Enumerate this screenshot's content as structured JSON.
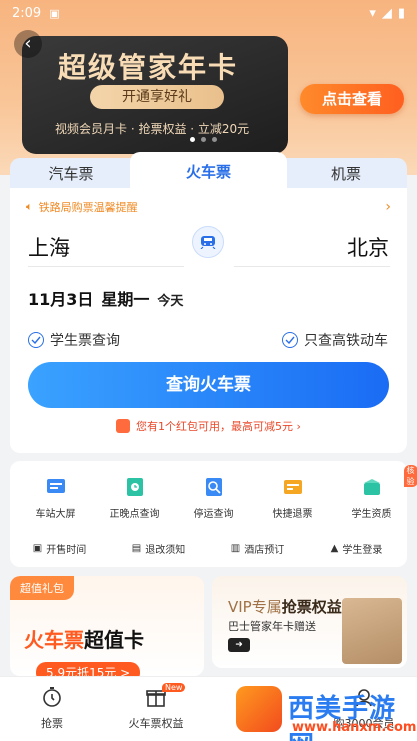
{
  "status_bar": {
    "time": "2:09"
  },
  "banner": {
    "title": "超级管家年卡",
    "subtitle": "开通享好礼",
    "perks": "视频会员月卡 · 抢票权益 · 立减20元",
    "cta": "点击查看"
  },
  "tabs": [
    "汽车票",
    "火车票",
    "机票"
  ],
  "active_tab": "火车票",
  "booking": {
    "notice": "铁路局购票温馨提醒",
    "from_city": "上海",
    "to_city": "北京",
    "date": "11月3日",
    "weekday": "星期一",
    "day_tag": "今天",
    "option_student": "学生票查询",
    "option_highspeed": "只查高铁动车",
    "search_label": "查询火车票",
    "coupon_text": "您有1个红包可用，最高可减5元 ›"
  },
  "tools": {
    "items": [
      {
        "label": "车站大屏",
        "icon": "station-screen-icon"
      },
      {
        "label": "正晚点查询",
        "icon": "delay-query-icon"
      },
      {
        "label": "停运查询",
        "icon": "suspension-query-icon"
      },
      {
        "label": "快捷退票",
        "icon": "refund-icon"
      },
      {
        "label": "学生资质",
        "icon": "student-cert-icon",
        "badge": "核验"
      }
    ],
    "links": [
      {
        "label": "开售时间",
        "icon": "calendar-icon"
      },
      {
        "label": "退改须知",
        "icon": "document-icon"
      },
      {
        "label": "酒店预订",
        "icon": "hotel-icon"
      },
      {
        "label": "学生登录",
        "icon": "graduation-cap-icon"
      }
    ]
  },
  "promos": {
    "left_tag": "超值礼包",
    "left_title_a": "火车票",
    "left_title_b": "超值卡",
    "left_price": "5.9元抵15元 >",
    "right_title_a": "VIP专属",
    "right_title_b": "抢票权益",
    "right_sub": "巴士管家年卡赠送"
  },
  "bottom_nav": {
    "items": [
      {
        "label": "抢票"
      },
      {
        "label": "火车票权益",
        "badge": "New"
      },
      {
        "label": ""
      },
      {
        "label": "购3000会员"
      }
    ]
  },
  "watermark": {
    "text": "西美手游网",
    "url": "www.hanxm.com"
  },
  "colors": {
    "primary": "#2a6fe8",
    "accent": "#ff5a1f",
    "banner_bg": "#f7b47f"
  }
}
